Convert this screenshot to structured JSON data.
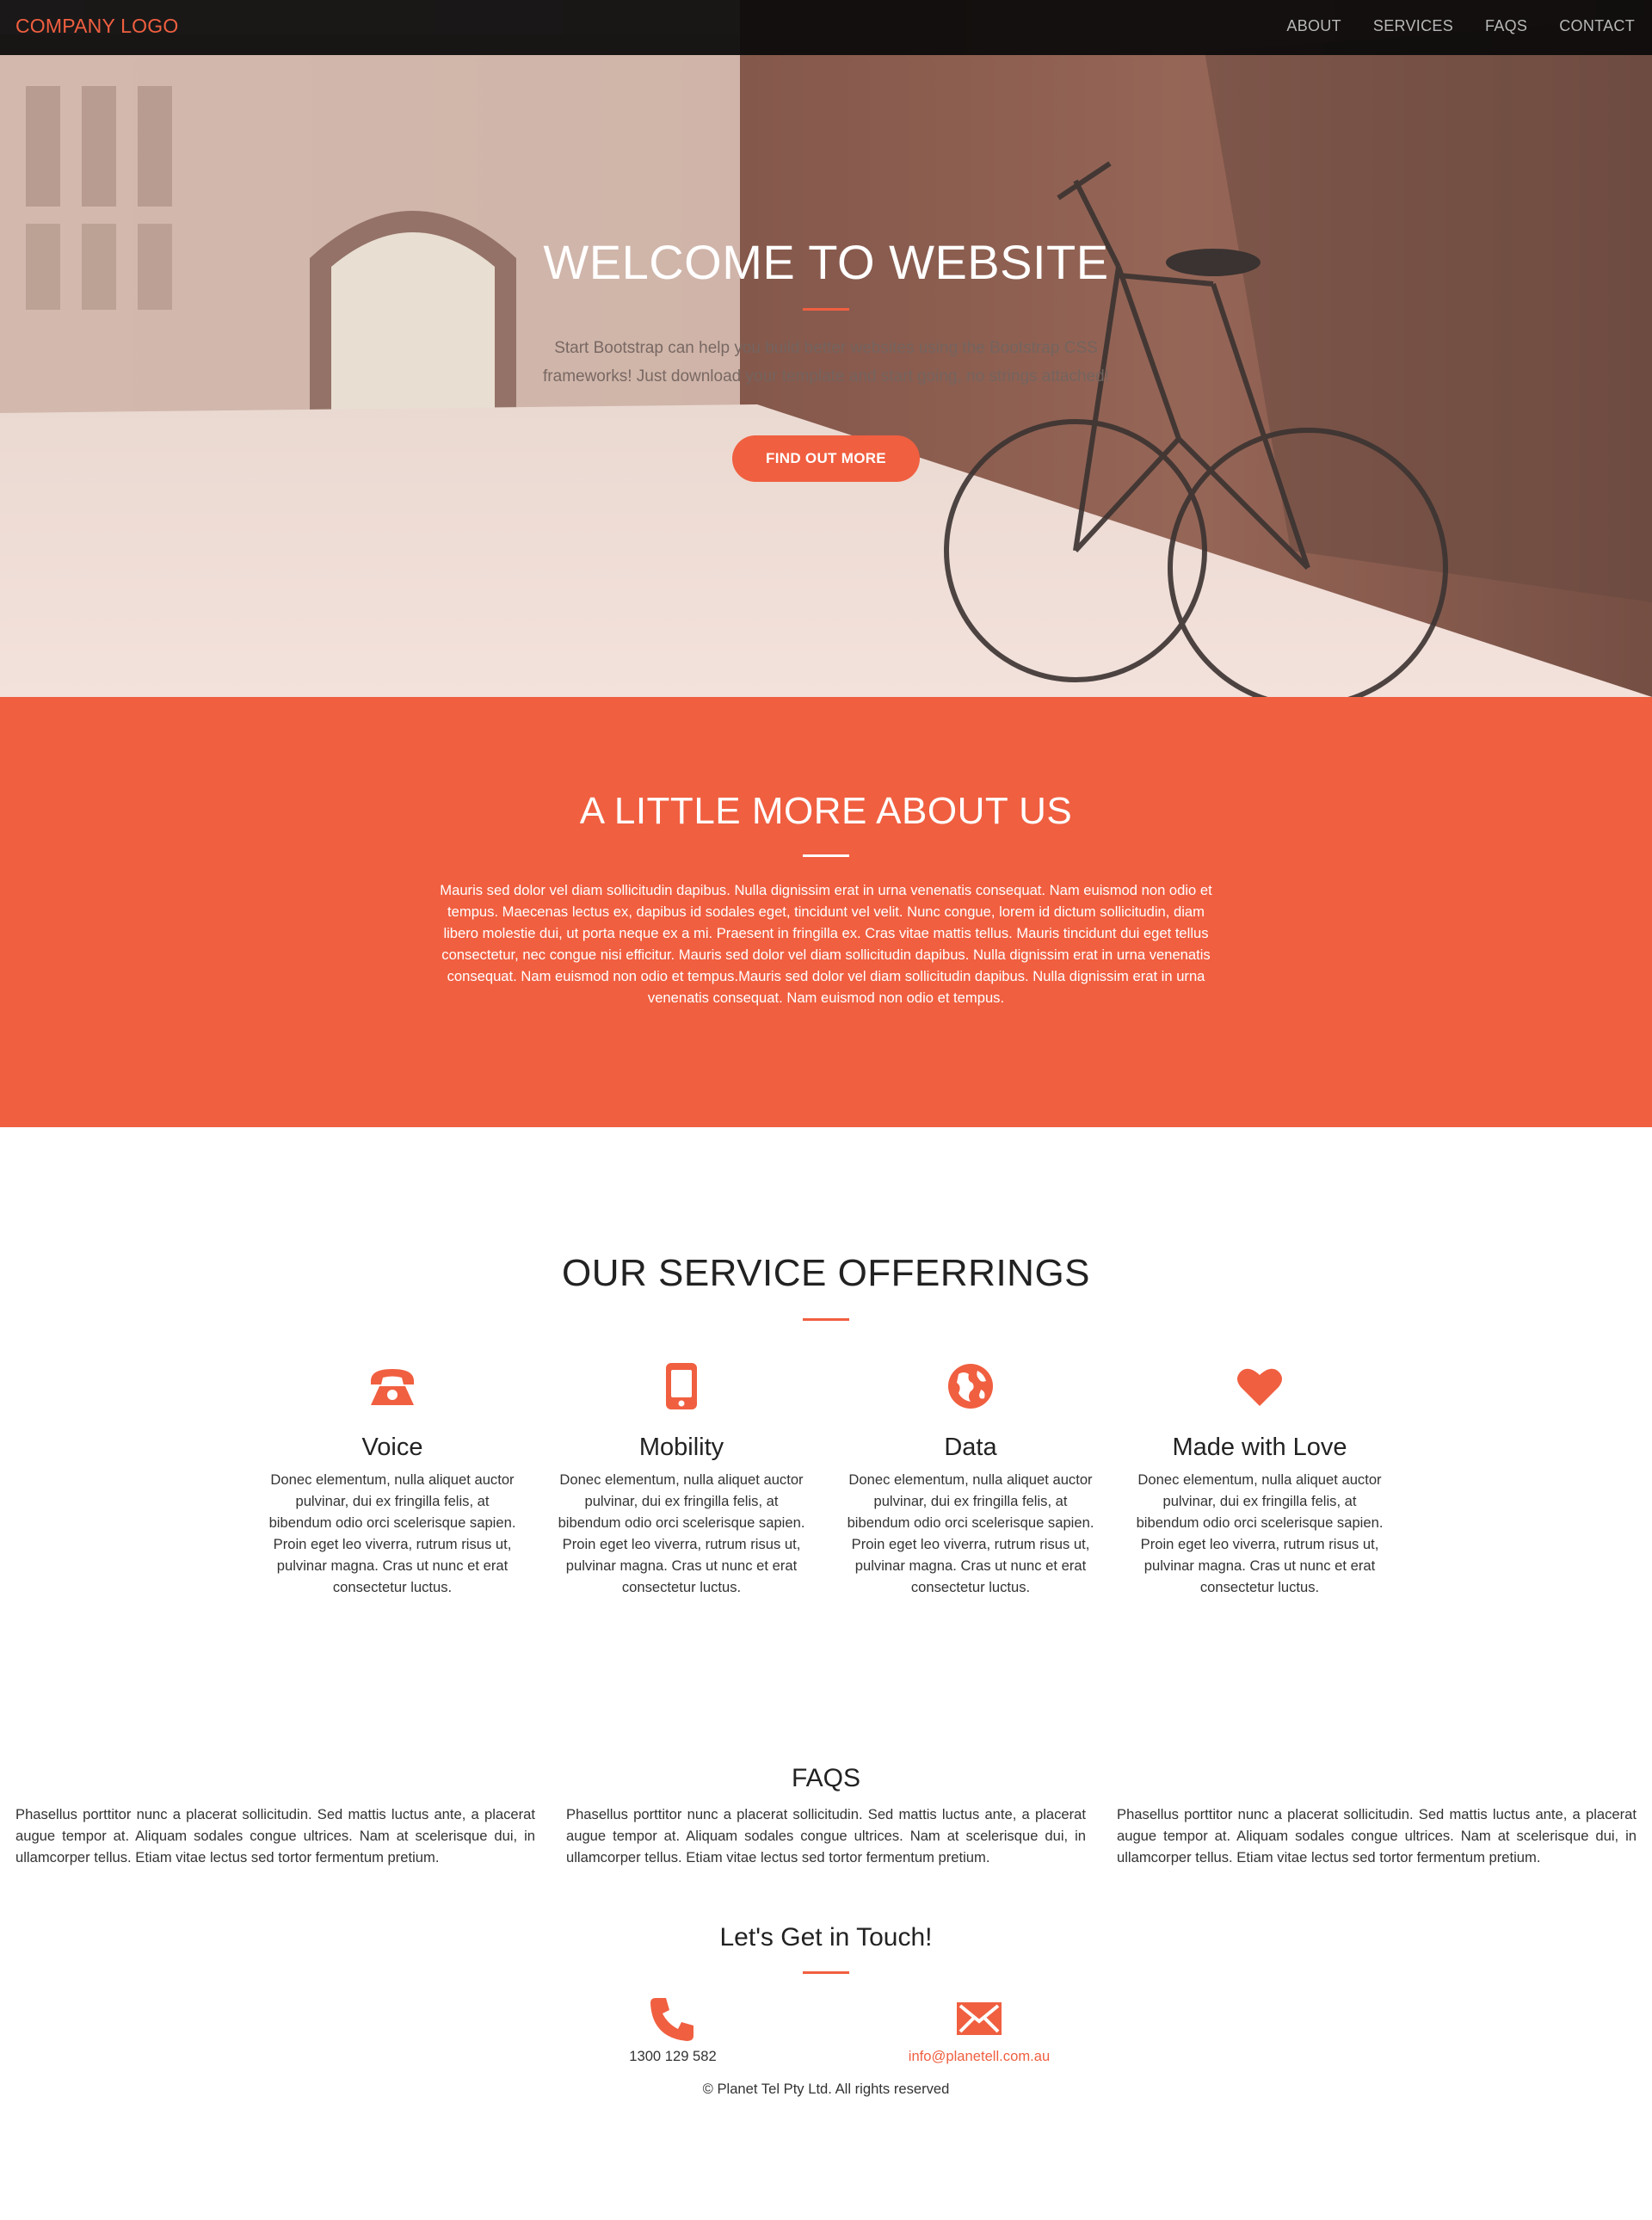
{
  "colors": {
    "accent": "#f05f40",
    "nav_bg": "#0a0a0a",
    "text": "#222222"
  },
  "nav": {
    "brand": "COMPANY LOGO",
    "links": [
      "ABOUT",
      "SERVICES",
      "FAQS",
      "CONTACT"
    ]
  },
  "hero": {
    "title": "WELCOME TO WEBSITE",
    "subtitle": "Start Bootstrap can help you build better websites using the Bootstrap CSS frameworks! Just download your template and start going, no strings attached!",
    "cta": "FIND OUT MORE",
    "image": "bicycle-leaning-on-stone-wall"
  },
  "about": {
    "title": "A LITTLE MORE ABOUT US",
    "text": "Mauris sed dolor vel diam sollicitudin dapibus. Nulla dignissim erat in urna venenatis consequat. Nam euismod non odio et tempus. Maecenas lectus ex, dapibus id sodales eget, tincidunt vel velit. Nunc congue, lorem id dictum sollicitudin, diam libero molestie dui, ut porta neque ex a mi. Praesent in fringilla ex. Cras vitae mattis tellus. Mauris tincidunt dui eget tellus consectetur, nec congue nisi efficitur. Mauris sed dolor vel diam sollicitudin dapibus. Nulla dignissim erat in urna venenatis consequat. Nam euismod non odio et tempus.Mauris sed dolor vel diam sollicitudin dapibus. Nulla dignissim erat in urna venenatis consequat. Nam euismod non odio et tempus."
  },
  "services": {
    "title": "OUR SERVICE OFFERRINGS",
    "items": [
      {
        "icon": "phone-icon",
        "name": "Voice",
        "text": "Donec elementum, nulla aliquet auctor pulvinar, dui ex fringilla felis, at bibendum odio orci scelerisque sapien. Proin eget leo viverra, rutrum risus ut, pulvinar magna. Cras ut nunc et erat consectetur luctus."
      },
      {
        "icon": "mobile-icon",
        "name": "Mobility",
        "text": "Donec elementum, nulla aliquet auctor pulvinar, dui ex fringilla felis, at bibendum odio orci scelerisque sapien. Proin eget leo viverra, rutrum risus ut, pulvinar magna. Cras ut nunc et erat consectetur luctus."
      },
      {
        "icon": "globe-icon",
        "name": "Data",
        "text": "Donec elementum, nulla aliquet auctor pulvinar, dui ex fringilla felis, at bibendum odio orci scelerisque sapien. Proin eget leo viverra, rutrum risus ut, pulvinar magna. Cras ut nunc et erat consectetur luctus."
      },
      {
        "icon": "heart-icon",
        "name": "Made with Love",
        "text": "Donec elementum, nulla aliquet auctor pulvinar, dui ex fringilla felis, at bibendum odio orci scelerisque sapien. Proin eget leo viverra, rutrum risus ut, pulvinar magna. Cras ut nunc et erat consectetur luctus."
      }
    ]
  },
  "faqs": {
    "title": "FAQS",
    "columns": [
      "Phasellus porttitor nunc a placerat sollicitudin. Sed mattis luctus ante, a placerat augue tempor at. Aliquam sodales congue ultrices. Nam at scelerisque dui, in ullamcorper tellus. Etiam vitae lectus sed tortor fermentum pretium.",
      "Phasellus porttitor nunc a placerat sollicitudin. Sed mattis luctus ante, a placerat augue tempor at. Aliquam sodales congue ultrices. Nam at scelerisque dui, in ullamcorper tellus. Etiam vitae lectus sed tortor fermentum pretium.",
      "Phasellus porttitor nunc a placerat sollicitudin. Sed mattis luctus ante, a placerat augue tempor at. Aliquam sodales congue ultrices. Nam at scelerisque dui, in ullamcorper tellus. Etiam vitae lectus sed tortor fermentum pretium."
    ]
  },
  "contact": {
    "title": "Let's Get in Touch!",
    "phone": "1300 129 582",
    "email": "info@planetell.com.au",
    "copyright": "© Planet Tel Pty Ltd. All rights reserved"
  }
}
